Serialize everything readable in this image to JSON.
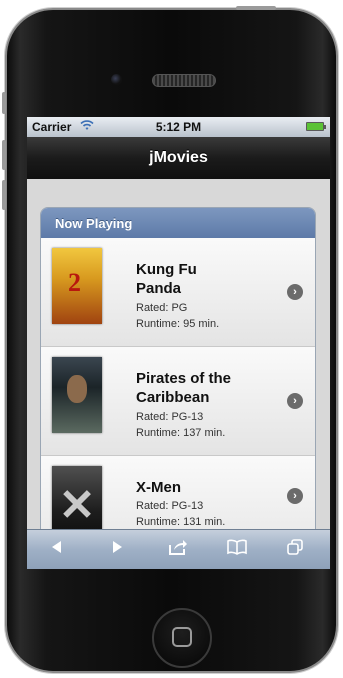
{
  "status": {
    "carrier": "Carrier",
    "time": "5:12 PM"
  },
  "nav": {
    "title": "jMovies"
  },
  "list": {
    "header": "Now Playing",
    "movies": [
      {
        "title_line1": "Kung Fu",
        "title_line2": "Panda",
        "rated": "Rated: PG",
        "runtime": "Runtime: 95 min."
      },
      {
        "title_line1": "Pirates of the",
        "title_line2": "Caribbean",
        "rated": "Rated: PG-13",
        "runtime": "Runtime: 137 min."
      },
      {
        "title_line1": "X-Men",
        "title_line2": "",
        "rated": "Rated: PG-13",
        "runtime": "Runtime: 131 min."
      }
    ]
  },
  "toolbar": {
    "icons": [
      "back-arrow-icon",
      "forward-arrow-icon",
      "share-icon",
      "bookmarks-icon",
      "tabs-icon"
    ]
  },
  "colors": {
    "navbar": "#1b1b1b",
    "list_header": "#6a86b4",
    "toolbar": "#9fb0c6",
    "battery": "#5bc236"
  }
}
